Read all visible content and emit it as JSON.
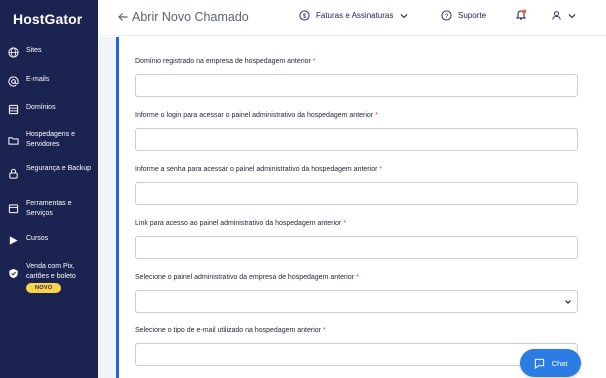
{
  "brand": {
    "logo_text": "HostGator"
  },
  "sidebar": {
    "items": [
      {
        "label": "Sites",
        "icon": "globe-icon"
      },
      {
        "label": "E-mails",
        "icon": "at-icon"
      },
      {
        "label": "Domínios",
        "icon": "server-icon"
      },
      {
        "label": "Hospedagens e Servidores",
        "icon": "folder-icon"
      },
      {
        "label": "Segurança e Backup",
        "icon": "lock-icon"
      },
      {
        "label": "Ferramentas e Serviços",
        "icon": "calendar-icon"
      },
      {
        "label": "Cursos",
        "icon": "play-icon"
      },
      {
        "label": "Venda com Pix, cartões e boleto",
        "icon": "shield-icon",
        "badge": "NOVO"
      }
    ]
  },
  "header": {
    "back_icon": "arrow-left-icon",
    "title": "Abrir Novo Chamado",
    "billing_label": "Faturas e Assinaturas",
    "support_label": "Suporte"
  },
  "form": {
    "fields": [
      {
        "label": "Domínio registrado na empresa de hospedagem anterior",
        "required_mark": "*",
        "type": "text",
        "value": ""
      },
      {
        "label": "Informe o login para acessar o painel administrativo da hospedagem anterior",
        "required_mark": "*",
        "type": "text",
        "value": ""
      },
      {
        "label": "Informe a senha para acessar o painel administrativo da hospedagem anterior",
        "required_mark": "*",
        "type": "text",
        "value": ""
      },
      {
        "label": "Link para acesso ao painel administrativo da hospedagem anterior",
        "required_mark": "*",
        "type": "text",
        "value": ""
      },
      {
        "label": "Selecione o painel administrativo da empresa de hospedagem anterior",
        "required_mark": "*",
        "type": "select",
        "value": ""
      },
      {
        "label": "Selecione o tipo de e-mail utilizado na hospedagem anterior",
        "required_mark": "*",
        "type": "text",
        "value": ""
      }
    ]
  },
  "chat": {
    "label": "Chat"
  },
  "colors": {
    "sidebar_bg": "#1b2350",
    "accent": "#2463eb",
    "chat_bg": "#2b7de3",
    "badge_bg": "#fcd34d",
    "required": "#e3433b"
  }
}
